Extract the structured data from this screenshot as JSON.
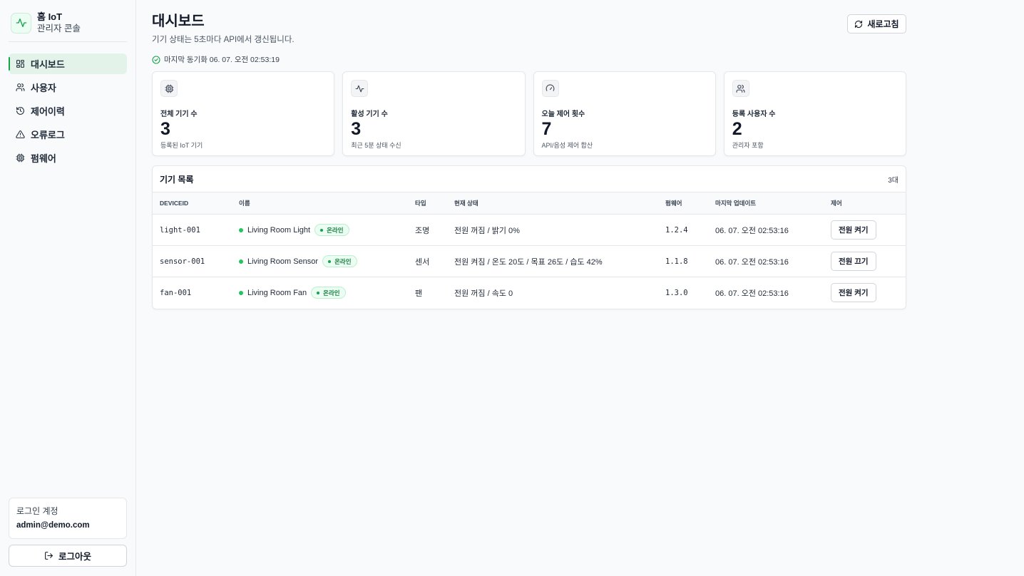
{
  "brand": {
    "title": "홈 IoT",
    "subtitle": "관리자 콘솔"
  },
  "nav": [
    {
      "label": "대시보드",
      "icon": "grid-icon",
      "active": true
    },
    {
      "label": "사용자",
      "icon": "users-icon"
    },
    {
      "label": "제어이력",
      "icon": "history-icon"
    },
    {
      "label": "오류로그",
      "icon": "warning-icon"
    },
    {
      "label": "펌웨어",
      "icon": "chip-icon"
    }
  ],
  "account": {
    "label": "로그인 계정",
    "email": "admin@demo.com"
  },
  "logout_label": "로그아웃",
  "header": {
    "title": "대시보드",
    "description": "기기 상태는 5초마다 API에서 갱신됩니다.",
    "refresh_label": "새로고침",
    "sync_text": "마지막 동기화 06. 07. 오전 02:53:19"
  },
  "stats": [
    {
      "label": "전체 기기 수",
      "value": "3",
      "sub": "등록된 IoT 기기",
      "icon": "chip-icon"
    },
    {
      "label": "활성 기기 수",
      "value": "3",
      "sub": "최근 5분 상태 수신",
      "icon": "activity-icon"
    },
    {
      "label": "오늘 제어 횟수",
      "value": "7",
      "sub": "API/음성 제어 합산",
      "icon": "gauge-icon"
    },
    {
      "label": "등록 사용자 수",
      "value": "2",
      "sub": "관리자 포함",
      "icon": "users-icon"
    }
  ],
  "devices": {
    "title": "기기 목록",
    "count": "3대",
    "columns": [
      "DEVICEID",
      "이름",
      "타입",
      "현재 상태",
      "펌웨어",
      "마지막 업데이트",
      "제어"
    ],
    "rows": [
      {
        "id": "light-001",
        "name": "Living Room Light",
        "status_badge": "온라인",
        "type": "조명",
        "state": "전원 꺼짐 / 밝기 0%",
        "firmware": "1.2.4",
        "updated": "06. 07. 오전 02:53:16",
        "action": "전원 켜기"
      },
      {
        "id": "sensor-001",
        "name": "Living Room Sensor",
        "status_badge": "온라인",
        "type": "센서",
        "state": "전원 켜짐 / 온도 20도 / 목표 26도 / 습도 42%",
        "firmware": "1.1.8",
        "updated": "06. 07. 오전 02:53:16",
        "action": "전원 끄기"
      },
      {
        "id": "fan-001",
        "name": "Living Room Fan",
        "status_badge": "온라인",
        "type": "팬",
        "state": "전원 꺼짐 / 속도 0",
        "firmware": "1.3.0",
        "updated": "06. 07. 오전 02:53:16",
        "action": "전원 켜기"
      }
    ]
  },
  "colors": {
    "accent": "#16a34a",
    "online": "#22c55e"
  }
}
